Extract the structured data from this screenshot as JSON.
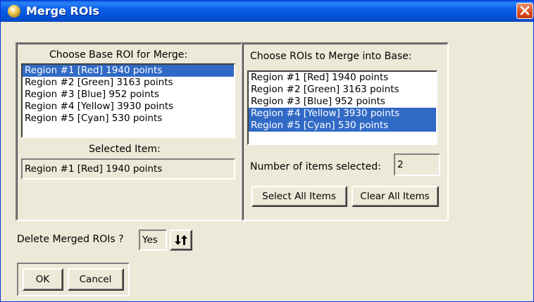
{
  "window": {
    "title": "Merge ROIs"
  },
  "base": {
    "heading": "Choose Base ROI for Merge:",
    "items": [
      "Region #1 [Red] 1940 points",
      "Region #2 [Green] 3163 points",
      "Region #3 [Blue] 952 points",
      "Region #4 [Yellow] 3930 points",
      "Region #5 [Cyan] 530 points"
    ],
    "selected_label": "Selected Item:",
    "selected_value": "Region #1 [Red] 1940 points"
  },
  "merge": {
    "heading": "Choose ROIs to Merge into Base:",
    "items": [
      "Region #1 [Red] 1940 points",
      "Region #2 [Green] 3163 points",
      "Region #3 [Blue] 952 points",
      "Region #4 [Yellow] 3930 points",
      "Region #5 [Cyan] 530 points"
    ],
    "count_label": "Number of items selected:",
    "count_value": "2",
    "select_all_label": "Select All Items",
    "clear_all_label": "Clear All Items"
  },
  "delete": {
    "label": "Delete Merged ROIs ?",
    "value": "Yes"
  },
  "buttons": {
    "ok": "OK",
    "cancel": "Cancel"
  },
  "icons": {
    "window": "envi-globe-icon",
    "close": "close-icon",
    "toggle": "toggle-arrows-icon"
  },
  "colors": {
    "title_bar": "#0a5ee9",
    "selection": "#316ac5",
    "face": "#ece9d8"
  }
}
